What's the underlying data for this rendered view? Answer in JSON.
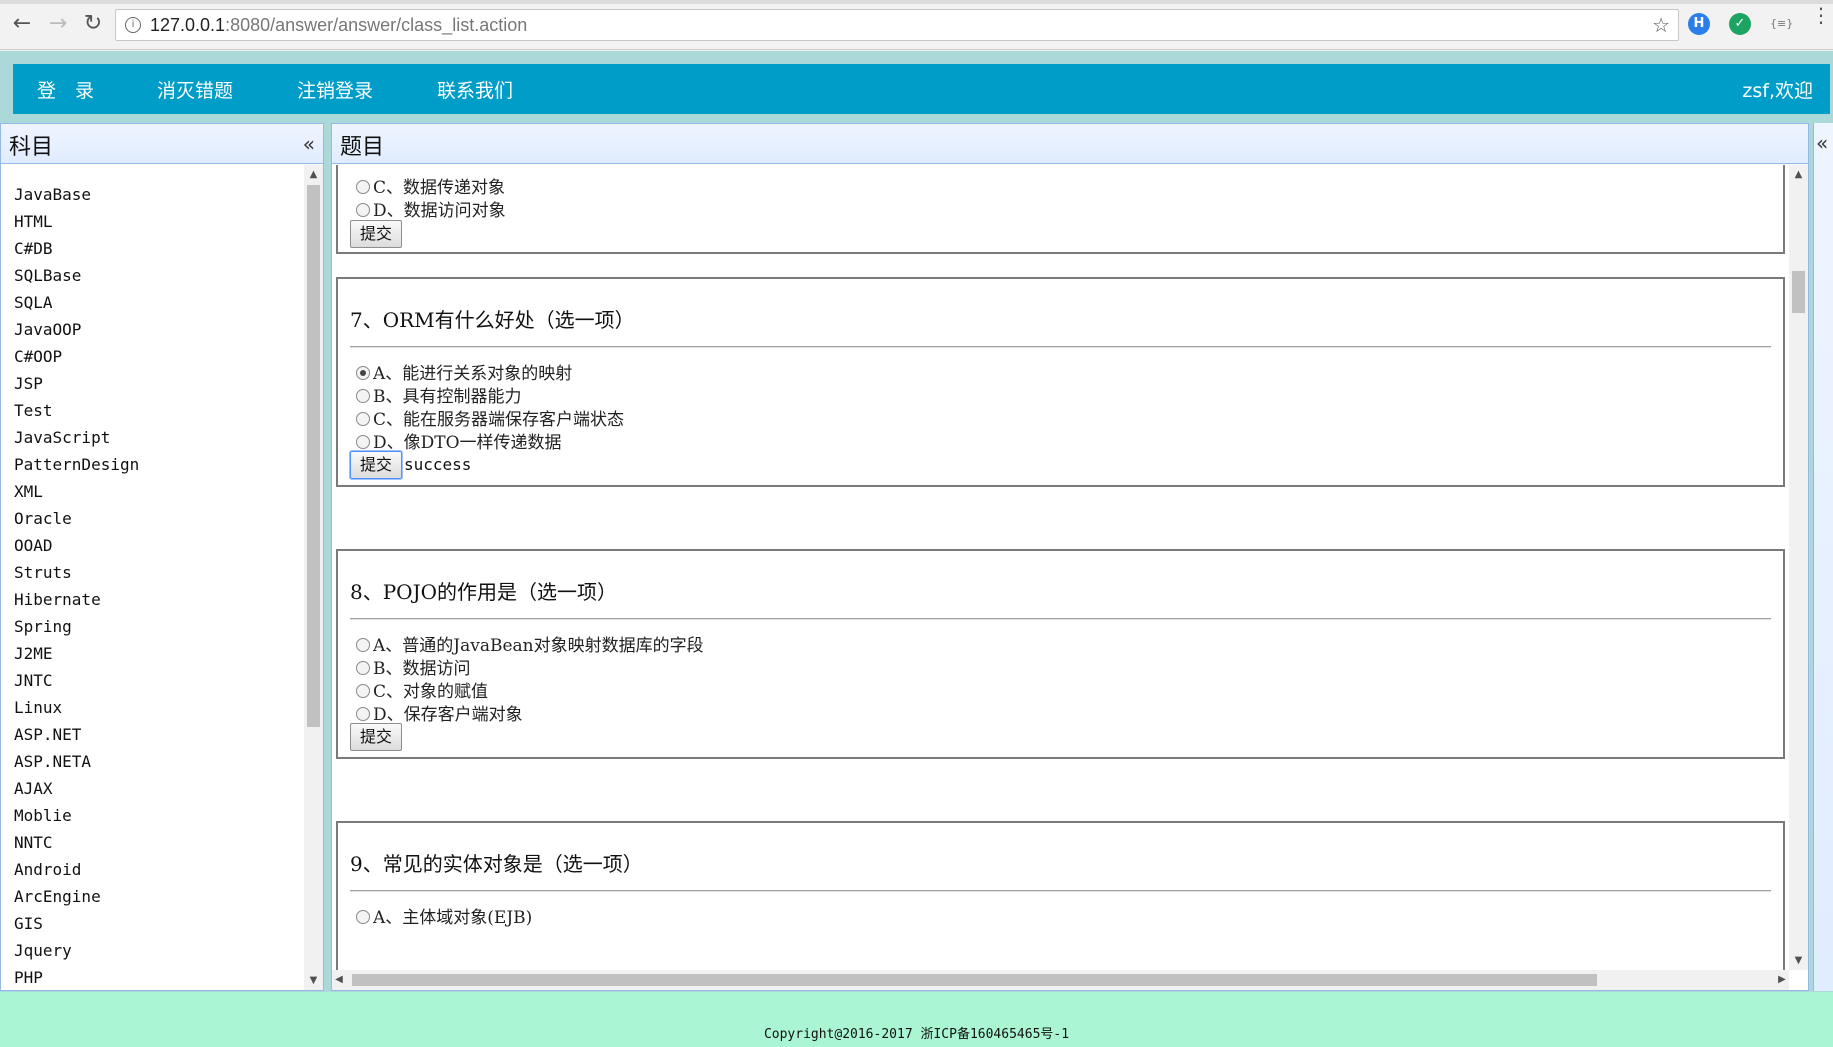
{
  "browser": {
    "url_host": "127.0.0.1",
    "url_rest": ":8080/answer/answer/class_list.action",
    "back_label": "←",
    "forward_label": "→",
    "reload_label": "↻",
    "info_label": "i",
    "star_label": "☆",
    "extensions": [
      {
        "icon": "h-extension-icon",
        "label": "H",
        "color": "#2b7de9"
      },
      {
        "icon": "shield-extension-icon",
        "label": "✓",
        "color": "#1da462"
      },
      {
        "icon": "json-extension-icon",
        "label": "{≡}",
        "color": "#777777"
      }
    ],
    "menu_label": "⋮"
  },
  "nav": {
    "items": [
      "登　录",
      "消灭错题",
      "注销登录",
      "联系我们"
    ],
    "welcome": "zsf,欢迎"
  },
  "left_panel": {
    "title": "科目",
    "collapse": "«",
    "subjects": [
      "JavaBase",
      "HTML",
      "C#DB",
      "SQLBase",
      "SQLA",
      "JavaOOP",
      "C#OOP",
      "JSP",
      "Test",
      "JavaScript",
      "PatternDesign",
      "XML",
      "Oracle",
      "OOAD",
      "Struts",
      "Hibernate",
      "Spring",
      "J2ME",
      "JNTC",
      "Linux",
      "ASP.NET",
      "ASP.NETA",
      "AJAX",
      "Moblie",
      "NNTC",
      "Android",
      "ArcEngine",
      "GIS",
      "Jquery",
      "PHP"
    ]
  },
  "right_panel": {
    "title": "题目",
    "collapse": "«",
    "questions": [
      {
        "title": "",
        "options": [
          {
            "label": "C、数据传递对象",
            "checked": false
          },
          {
            "label": "D、数据访问对象",
            "checked": false
          }
        ],
        "submit": "提交",
        "result": ""
      },
      {
        "title": "7、ORM有什么好处（选一项）",
        "options": [
          {
            "label": "A、能进行关系对象的映射",
            "checked": true
          },
          {
            "label": "B、具有控制器能力",
            "checked": false
          },
          {
            "label": "C、能在服务器端保存客户端状态",
            "checked": false
          },
          {
            "label": "D、像DTO一样传递数据",
            "checked": false
          }
        ],
        "submit": "提交",
        "result": "success"
      },
      {
        "title": "8、POJO的作用是（选一项）",
        "options": [
          {
            "label": "A、普通的JavaBean对象映射数据库的字段",
            "checked": false
          },
          {
            "label": "B、数据访问",
            "checked": false
          },
          {
            "label": "C、对象的赋值",
            "checked": false
          },
          {
            "label": "D、保存客户端对象",
            "checked": false
          }
        ],
        "submit": "提交",
        "result": ""
      },
      {
        "title": "9、常见的实体对象是（选一项）",
        "options": [
          {
            "label": "A、主体域对象(EJB)",
            "checked": false
          }
        ],
        "submit": "",
        "result": ""
      }
    ]
  },
  "right_edge": {
    "collapse": "«"
  },
  "footer": {
    "copyright": "Copyright@2016-2017 浙ICP备160465465号-1"
  }
}
